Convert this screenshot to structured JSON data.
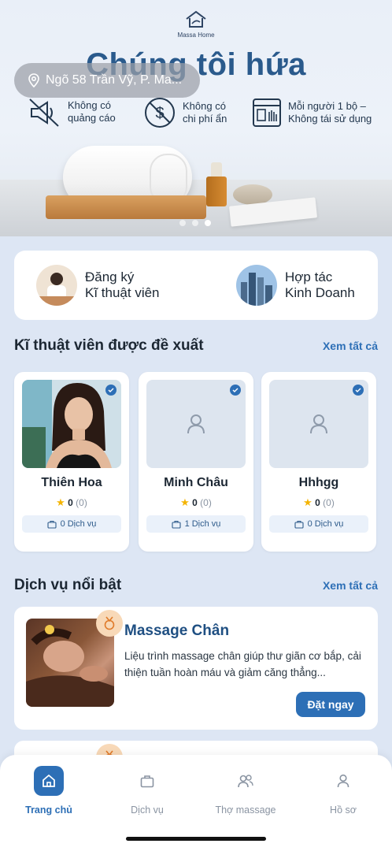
{
  "hero": {
    "logo_text": "Massa Home",
    "title": "Chúng tôi hứa",
    "location": "Ngõ 58 Trần Vỹ, P. Ma...",
    "promises": [
      {
        "icon": "no-ads-icon",
        "line1": "Không có",
        "line2": "quảng cáo"
      },
      {
        "icon": "no-hidden-fee-icon",
        "line1": "Không có",
        "line2": "chi phí ẩn"
      },
      {
        "icon": "single-use-kit-icon",
        "line1": "Mỗi người 1 bộ –",
        "line2": "Không tái sử dụng"
      }
    ],
    "slide_count": 3,
    "active_slide": 3
  },
  "register": {
    "technician": {
      "line1": "Đăng ký",
      "line2": "Kĩ thuật viên"
    },
    "partner": {
      "line1": "Hợp tác",
      "line2": "Kinh Doanh"
    }
  },
  "technicians_section": {
    "title": "Kĩ thuật viên được đề xuất",
    "see_all": "Xem tất cả",
    "items": [
      {
        "name": "Thiên Hoa",
        "rating": "0",
        "reviews": "(0)",
        "services": "0 Dịch vụ"
      },
      {
        "name": "Minh Châu",
        "rating": "0",
        "reviews": "(0)",
        "services": "1 Dịch vụ"
      },
      {
        "name": "Hhhgg",
        "rating": "0",
        "reviews": "(0)",
        "services": "0 Dịch vụ"
      }
    ]
  },
  "services_section": {
    "title": "Dịch vụ nổi bật",
    "see_all": "Xem tất cả",
    "featured": {
      "name": "Massage Chân",
      "description": "Liệu trình massage chân giúp thư giãn cơ bắp, cải thiện tuần hoàn máu và giảm căng thẳng...",
      "cta": "Đặt ngay"
    }
  },
  "bottom_nav": {
    "items": [
      {
        "label": "Trang chủ",
        "icon": "home-icon",
        "active": true
      },
      {
        "label": "Dịch vụ",
        "icon": "briefcase-icon",
        "active": false
      },
      {
        "label": "Thợ massage",
        "icon": "users-icon",
        "active": false
      },
      {
        "label": "Hồ sơ",
        "icon": "user-icon",
        "active": false
      }
    ]
  },
  "colors": {
    "accent": "#2d6fb6",
    "background": "#dde6f4",
    "title_blue": "#2a5a8c",
    "star": "#f4b400"
  }
}
